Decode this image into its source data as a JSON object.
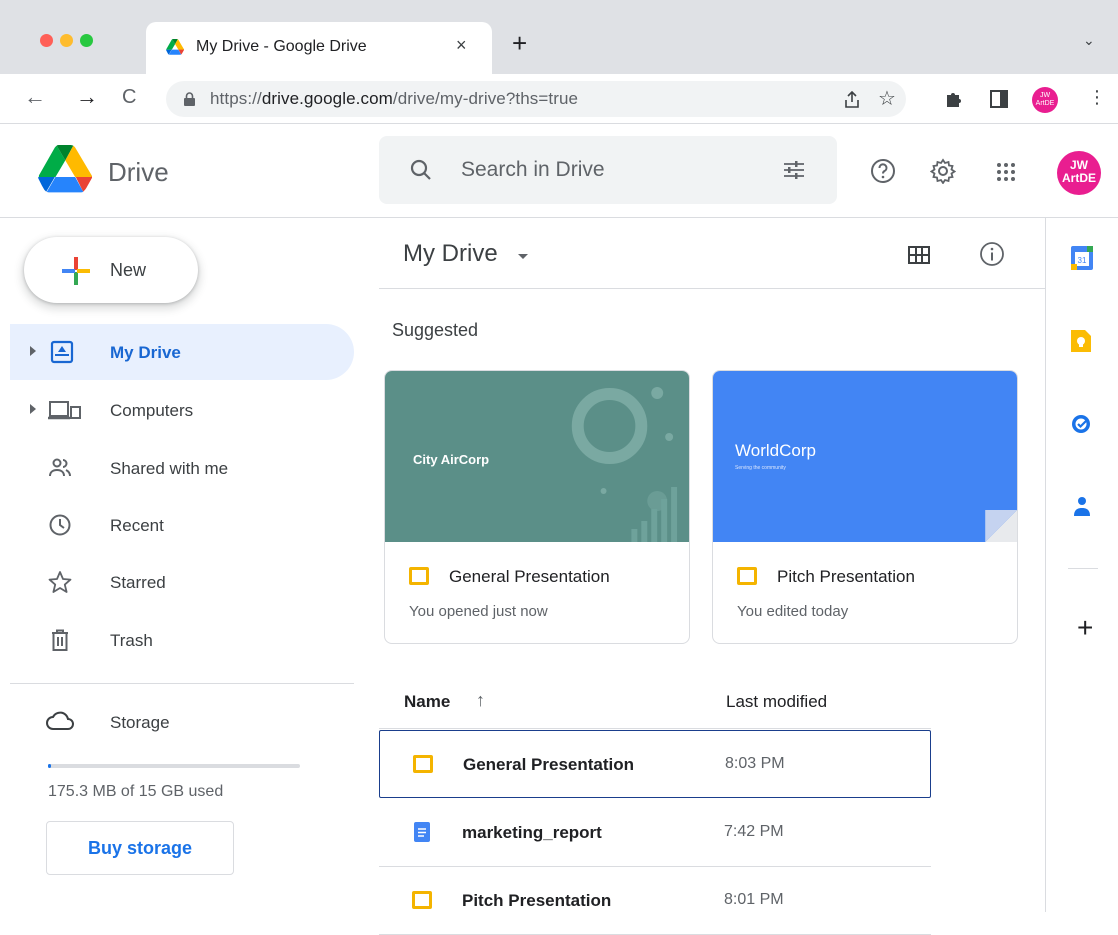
{
  "browser": {
    "tab_title": "My Drive - Google Drive",
    "tab_close": "×",
    "new_tab": "+",
    "tab_menu": "⌄",
    "url_prefix": "https://",
    "url_host": "drive.google.com",
    "url_path": "/drive/my-drive?ths=true",
    "profile_initials": "JW ArtDE"
  },
  "header": {
    "app_name": "Drive",
    "search_placeholder": "Search in Drive",
    "avatar_initials": "JW ArtDE"
  },
  "sidebar": {
    "new_label": "New",
    "items": [
      {
        "label": "My Drive",
        "icon": "my-drive-icon",
        "active": true
      },
      {
        "label": "Computers",
        "icon": "computers-icon"
      },
      {
        "label": "Shared with me",
        "icon": "shared-icon"
      },
      {
        "label": "Recent",
        "icon": "clock-icon"
      },
      {
        "label": "Starred",
        "icon": "star-icon"
      },
      {
        "label": "Trash",
        "icon": "trash-icon"
      }
    ],
    "storage": {
      "label": "Storage",
      "used_text": "175.3 MB of 15 GB used",
      "used_fraction": 0.0117,
      "buy_label": "Buy storage"
    }
  },
  "main": {
    "title": "My Drive",
    "suggested_label": "Suggested",
    "cards": [
      {
        "thumb_text": "City AirCorp",
        "name": "General Presentation",
        "sub": "You opened just now",
        "thumb_color": "#5b8f88"
      },
      {
        "thumb_text": "WorldCorp",
        "thumb_subtext": "Serving the community",
        "name": "Pitch Presentation",
        "sub": "You edited today",
        "thumb_color": "#4285f4"
      }
    ],
    "list": {
      "col_name": "Name",
      "sort_arrow": "↑",
      "col_modified": "Last modified",
      "rows": [
        {
          "name": "General Presentation",
          "modified": "8:03 PM",
          "type": "slides",
          "selected": true
        },
        {
          "name": "marketing_report",
          "modified": "7:42 PM",
          "type": "doc"
        },
        {
          "name": "Pitch Presentation",
          "modified": "8:01 PM",
          "type": "slides"
        }
      ]
    }
  },
  "side_panel": {
    "add_label": "+",
    "calendar_day": "31"
  },
  "colors": {
    "accent": "#1a73e8",
    "active_bg": "#e8f0fe",
    "slides_yellow": "#f4b400"
  }
}
